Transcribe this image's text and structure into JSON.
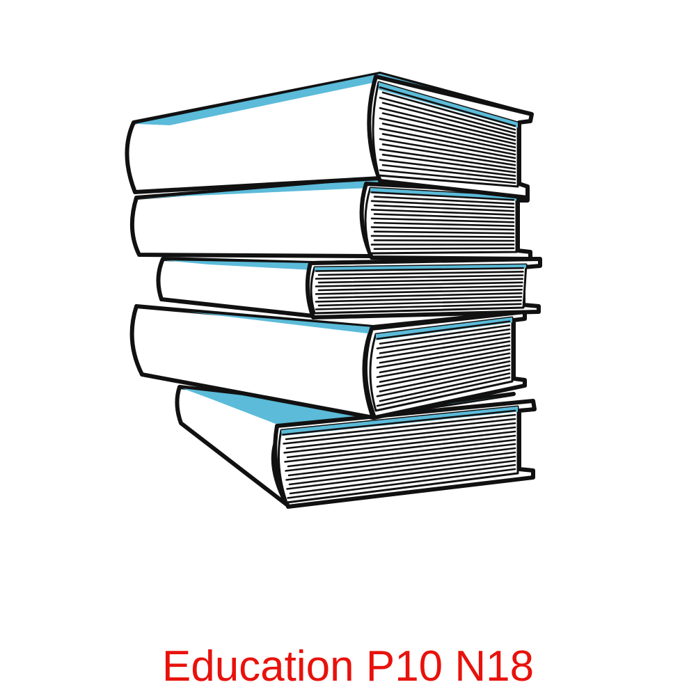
{
  "illustration": {
    "icon": "stack-of-books-icon",
    "book_count": 5,
    "colors": {
      "outline": "#111111",
      "cover": "#ffffff",
      "accent": "#5bbbd9",
      "pages": "#ffffff"
    }
  },
  "caption": {
    "text": "Education P10 N18",
    "color": "#e8120c"
  }
}
